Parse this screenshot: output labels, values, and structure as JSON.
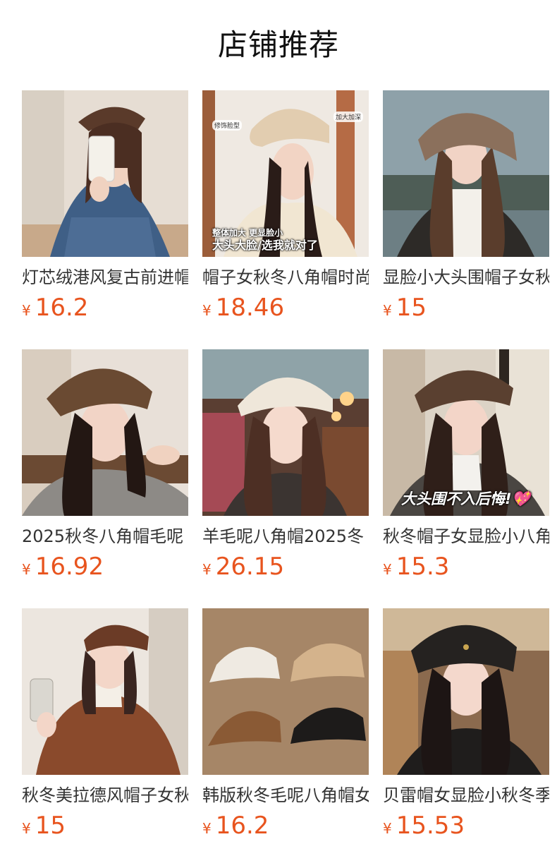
{
  "section": {
    "title": "店铺推荐"
  },
  "currency_symbol": "¥",
  "products": [
    {
      "name": "灯芯绒港风复古前进帽",
      "price": "16.2"
    },
    {
      "name": "帽子女秋冬八角帽时尚",
      "price": "18.46",
      "overlay": "整体加大 更显脸小",
      "overlay2": "大头大脸/选我就对了",
      "tag1": "修饰脸型",
      "tag2": "加大加深"
    },
    {
      "name": "显脸小大头围帽子女秋冬",
      "price": "15"
    },
    {
      "name": "2025秋冬八角帽毛呢",
      "price": "16.92"
    },
    {
      "name": "羊毛呢八角帽2025冬",
      "price": "26.15"
    },
    {
      "name": "秋冬帽子女显脸小八角",
      "price": "15.3",
      "overlay": "大头围不入后悔!💖"
    },
    {
      "name": "秋冬美拉德风帽子女秋",
      "price": "15"
    },
    {
      "name": "韩版秋冬毛呢八角帽女",
      "price": "16.2"
    },
    {
      "name": "贝雷帽女显脸小秋冬季",
      "price": "15.53"
    }
  ]
}
